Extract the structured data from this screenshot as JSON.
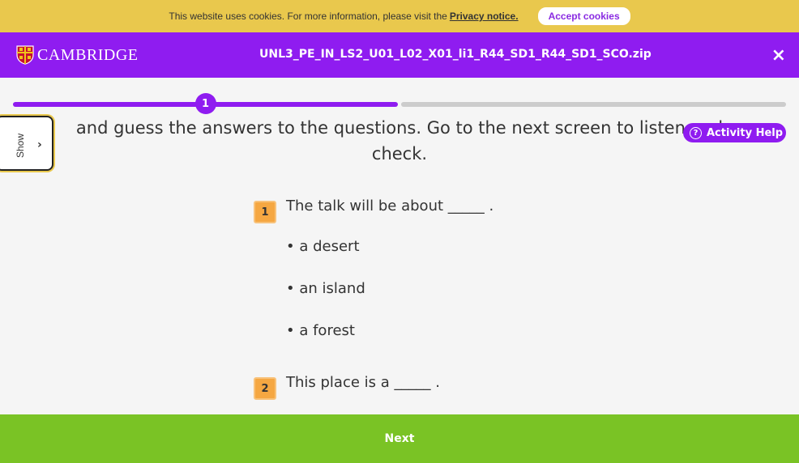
{
  "cookie_bar": {
    "text": "This website uses cookies. For more information, please visit the",
    "link": "Privacy notice.",
    "accept_label": "Accept cookies"
  },
  "header": {
    "logo_text": "CAMBRIDGE",
    "file_title": "UNL3_PE_IN_LS2_U01_L02_X01_li1_R44_SD1_R44_SD1_SCO.zip",
    "close_symbol": "×"
  },
  "progress": {
    "current_step": "1",
    "fraction_complete": 0.5
  },
  "instruction": "and guess the answers to the questions. Go to the next screen to listen and check.",
  "side_tab": {
    "label": "Show",
    "chevron": "›"
  },
  "activity_help": {
    "label": "Activity Help",
    "icon": "?"
  },
  "questions": [
    {
      "number": "1",
      "text": "The talk will be about _____ .",
      "options": [
        "• a desert",
        "• an island",
        "• a forest"
      ]
    },
    {
      "number": "2",
      "text": "This place is a _____ ."
    }
  ],
  "footer": {
    "next_label": "Next"
  },
  "colors": {
    "brand_purple": "#8f1cf0",
    "cookie_yellow": "#e9c84d",
    "next_green": "#7ac325",
    "number_orange": "#f5a742"
  }
}
